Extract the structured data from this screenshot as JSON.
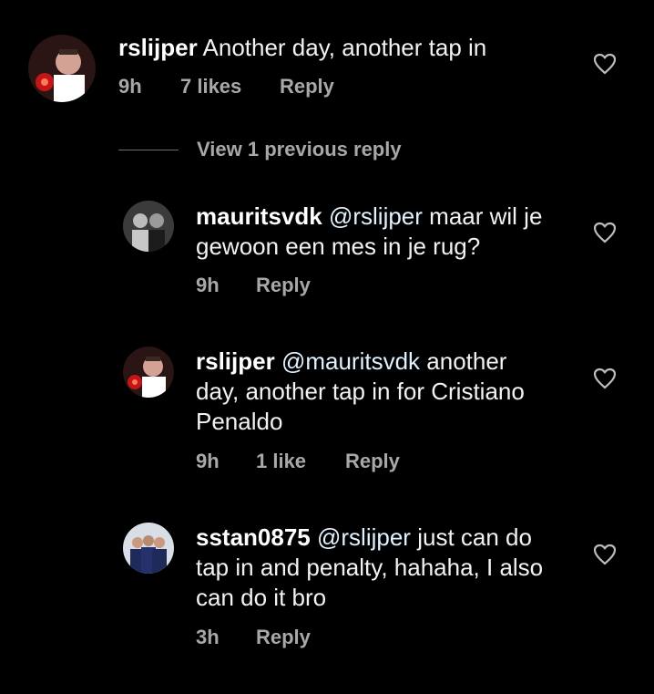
{
  "comments": [
    {
      "username": "rslijper",
      "mention": "",
      "text": "Another day, another tap in",
      "time": "9h",
      "likes": "7 likes",
      "reply": "Reply"
    },
    {
      "username": "mauritsvdk",
      "mention": "@rslijper",
      "text_line1": "maar wil je",
      "text_line2": "gewoon een mes in je rug?",
      "time": "9h",
      "reply": "Reply"
    },
    {
      "username": "rslijper",
      "mention": "@mauritsvdk",
      "text_line1": "another",
      "text_line2": "day, another tap in for Cristiano",
      "text_line3": "Penaldo",
      "time": "9h",
      "likes": "1 like",
      "reply": "Reply"
    },
    {
      "username": "sstan0875",
      "mention": "@rslijper",
      "text_line1": "just can do",
      "text_line2": "tap in and penalty, hahaha, I also",
      "text_line3": "can do it bro",
      "time": "3h",
      "reply": "Reply"
    }
  ],
  "view_previous": "View 1 previous reply",
  "colors": {
    "background": "#000000",
    "meta": "#a8a8a8",
    "mention": "#e0f1ff"
  },
  "icons": {
    "like": "heart-outline-icon"
  }
}
